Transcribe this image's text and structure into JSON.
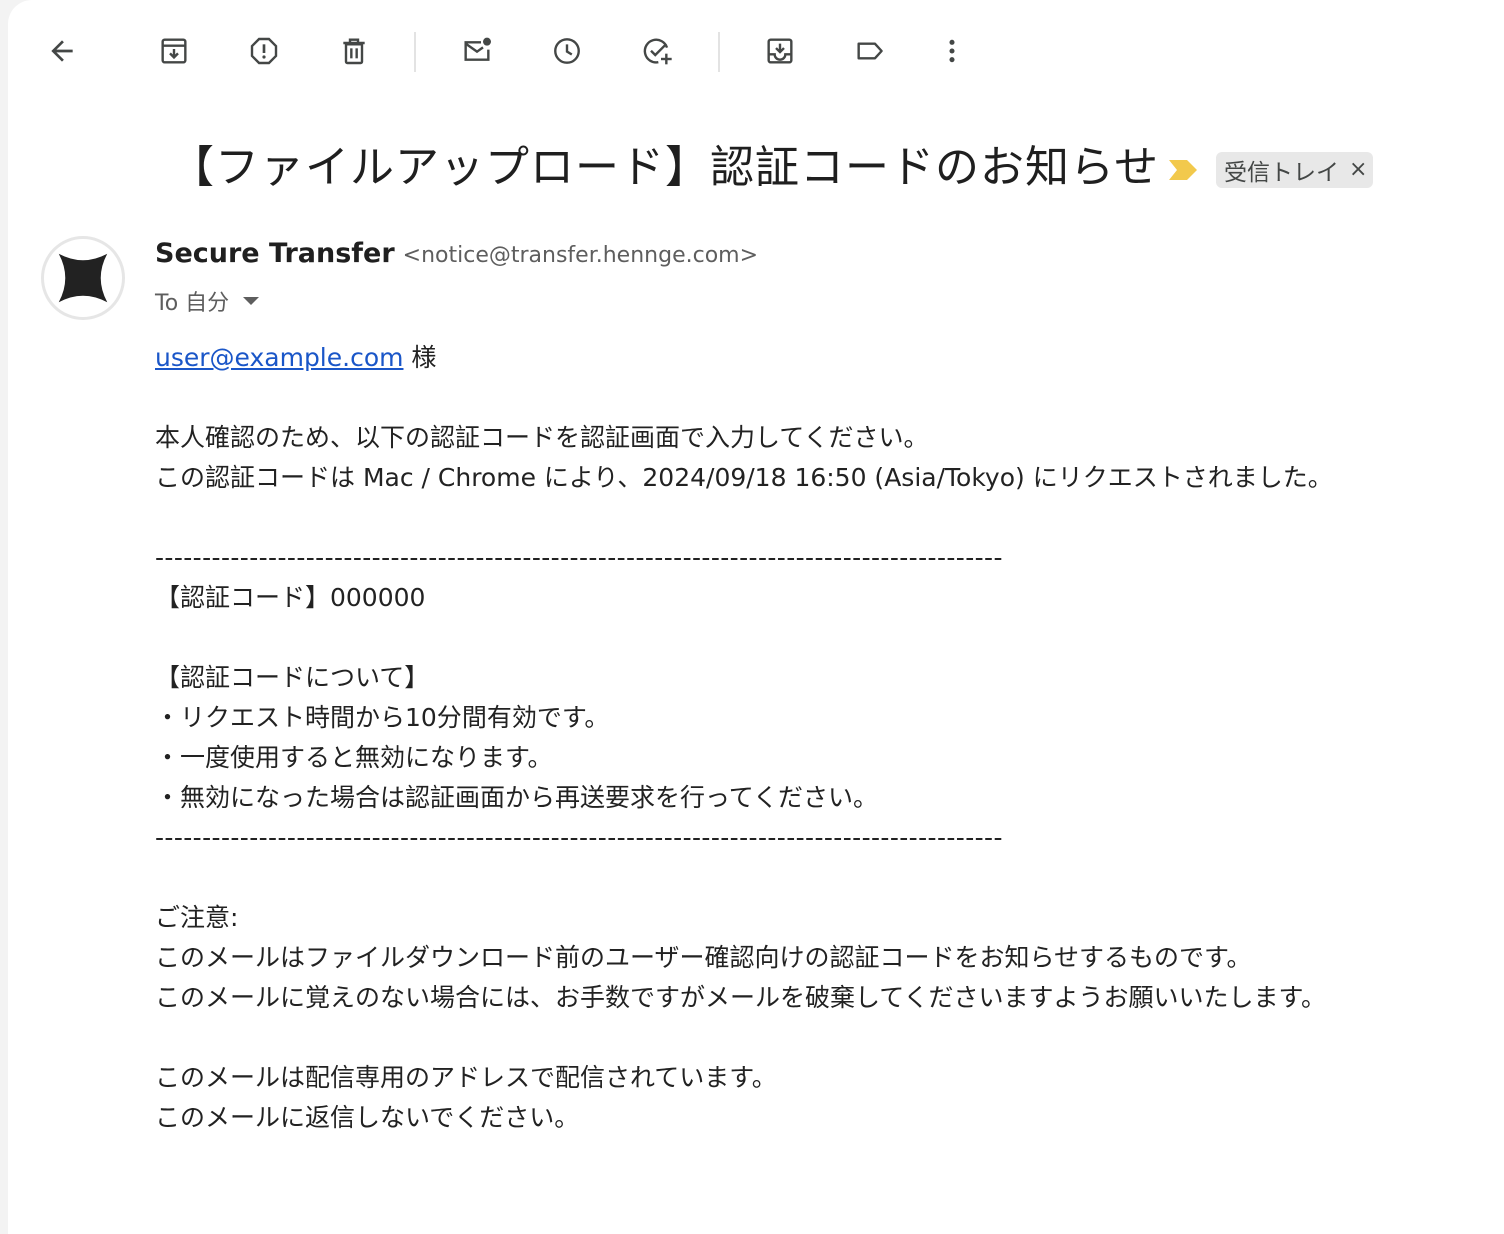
{
  "toolbar": {
    "buttons": [
      {
        "name": "back-button",
        "icon": "arrow-left-icon",
        "tooltip": "Back to Inbox"
      },
      {
        "name": "archive-button",
        "icon": "archive-icon",
        "tooltip": "Archive"
      },
      {
        "name": "report-spam-button",
        "icon": "report-icon",
        "tooltip": "Report spam"
      },
      {
        "name": "delete-button",
        "icon": "trash-icon",
        "tooltip": "Delete"
      },
      {
        "name": "mark-unread-button",
        "icon": "mail-unread-icon",
        "tooltip": "Mark as unread"
      },
      {
        "name": "snooze-button",
        "icon": "clock-icon",
        "tooltip": "Snooze"
      },
      {
        "name": "add-to-tasks-button",
        "icon": "task-add-icon",
        "tooltip": "Add to Tasks"
      },
      {
        "name": "move-to-button",
        "icon": "move-to-inbox-icon",
        "tooltip": "Move to"
      },
      {
        "name": "labels-button",
        "icon": "label-icon",
        "tooltip": "Labels"
      },
      {
        "name": "more-button",
        "icon": "more-vert-icon",
        "tooltip": "More"
      }
    ]
  },
  "message": {
    "subject": "【ファイルアップロード】認証コードのお知らせ",
    "label": "受信トレイ",
    "label_close": "×",
    "importance_color": "#f2c94c",
    "sender": {
      "name": "Secure Transfer",
      "email": "<notice@transfer.hennge.com>"
    },
    "to": "To 自分",
    "body": {
      "recipient_link": "user@example.com",
      "recipient_suffix": " 様",
      "intro": [
        "本人確認のため、以下の認証コードを認証画面で入力してください。",
        "この認証コードは Mac / Chrome により、2024/09/18 16:50 (Asia/Tokyo) にリクエストされました。"
      ],
      "divider": "------------------------------------------------------------------------------------------",
      "code_line": "【認証コード】000000",
      "about_heading": "【認証コードについて】",
      "about_items": [
        "・リクエスト時間から10分間有効です。",
        "・一度使用すると無効になります。",
        "・無効になった場合は認証画面から再送要求を行ってください。"
      ],
      "notice_heading": "ご注意:",
      "notice_lines": [
        "このメールはファイルダウンロード前のユーザー確認向けの認証コードをお知らせするものです。",
        "このメールに覚えのない場合には、お手数ですがメールを破棄してくださいますようお願いいたします。"
      ],
      "footer_lines": [
        "このメールは配信専用のアドレスで配信されています。",
        "このメールに返信しないでください。"
      ]
    }
  },
  "colors": {
    "link": "#1a56c8",
    "icon": "#444746",
    "chip_bg": "#e8e8e8"
  }
}
